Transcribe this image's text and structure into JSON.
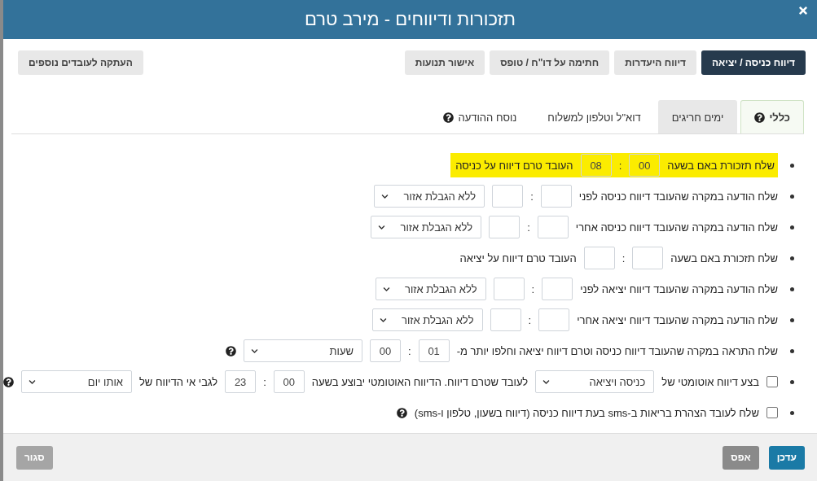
{
  "window": {
    "title": "תזכורות ודיווחים - מירב טרם"
  },
  "top_buttons": [
    {
      "label": "דיווח כניסה / יציאה",
      "selected": true
    },
    {
      "label": "דיווח היעדרות",
      "selected": false
    },
    {
      "label": "חתימה על דו\"ח / טופס",
      "selected": false
    },
    {
      "label": "אישור תנועות",
      "selected": false
    }
  ],
  "copy_button": {
    "label": "העתקה לעובדים נוספים"
  },
  "tabs": [
    {
      "label": "כללי",
      "selected": true,
      "help": true
    },
    {
      "label": "ימים חריגים",
      "selected": false,
      "help": false
    },
    {
      "label": "דוא\"ל וטלפון למשלוח",
      "selected": false,
      "help": false
    },
    {
      "label": "נוסח ההודעה",
      "selected": false,
      "help": true
    }
  ],
  "rows": [
    {
      "highlighted": true,
      "parts": [
        {
          "kind": "text",
          "text": "שלח תזכורת באם בשעה"
        },
        {
          "kind": "input",
          "value": "00"
        },
        {
          "kind": "text",
          "text": ":"
        },
        {
          "kind": "input",
          "value": "08"
        },
        {
          "kind": "text",
          "text": "העובד טרם דיווח על כניסה"
        }
      ]
    },
    {
      "highlighted": false,
      "parts": [
        {
          "kind": "text",
          "text": "שלח הודעה במקרה שהעובד דיווח כניסה לפני"
        },
        {
          "kind": "input"
        },
        {
          "kind": "text",
          "text": ":"
        },
        {
          "kind": "input"
        },
        {
          "kind": "select",
          "value": "ללא הגבלת אזור"
        }
      ]
    },
    {
      "highlighted": false,
      "parts": [
        {
          "kind": "text",
          "text": "שלח הודעה במקרה שהעובד דיווח כניסה אחרי"
        },
        {
          "kind": "input"
        },
        {
          "kind": "text",
          "text": ":"
        },
        {
          "kind": "input"
        },
        {
          "kind": "select",
          "value": "ללא הגבלת אזור"
        }
      ]
    },
    {
      "highlighted": false,
      "parts": [
        {
          "kind": "text",
          "text": "שלח תזכורת באם בשעה"
        },
        {
          "kind": "input"
        },
        {
          "kind": "text",
          "text": ":"
        },
        {
          "kind": "input"
        },
        {
          "kind": "text",
          "text": "העובד טרם דיווח על יציאה"
        }
      ]
    },
    {
      "highlighted": false,
      "parts": [
        {
          "kind": "text",
          "text": "שלח הודעה במקרה שהעובד דיווח יציאה לפני"
        },
        {
          "kind": "input"
        },
        {
          "kind": "text",
          "text": ":"
        },
        {
          "kind": "input"
        },
        {
          "kind": "select",
          "value": "ללא הגבלת אזור"
        }
      ]
    },
    {
      "highlighted": false,
      "parts": [
        {
          "kind": "text",
          "text": "שלח הודעה במקרה שהעובד דיווח יציאה אחרי"
        },
        {
          "kind": "input"
        },
        {
          "kind": "text",
          "text": ":"
        },
        {
          "kind": "input"
        },
        {
          "kind": "select",
          "value": "ללא הגבלת אזור"
        }
      ]
    },
    {
      "highlighted": false,
      "parts": [
        {
          "kind": "text",
          "text": "שלח התראה במקרה שהעובד דיווח כניסה וטרם דיווח יציאה וחלפו יותר מ-"
        },
        {
          "kind": "input",
          "value": "01"
        },
        {
          "kind": "text",
          "text": ":"
        },
        {
          "kind": "input",
          "value": "00"
        },
        {
          "kind": "select",
          "value": "שעות",
          "wide": true
        },
        {
          "kind": "help"
        }
      ]
    },
    {
      "highlighted": false,
      "parts": [
        {
          "kind": "checkbox",
          "checked": false
        },
        {
          "kind": "text",
          "text": "בצע דיווח אוטומטי של"
        },
        {
          "kind": "select",
          "value": "כניסה ויציאה",
          "wide": true
        },
        {
          "kind": "text",
          "text": "לעובד שטרם דיווח. הדיווח האוטומטי יבוצע בשעה"
        },
        {
          "kind": "input",
          "value": "00"
        },
        {
          "kind": "text",
          "text": ":"
        },
        {
          "kind": "input",
          "value": "23"
        },
        {
          "kind": "text",
          "text": "לגבי אי הדיווח של"
        },
        {
          "kind": "select",
          "value": "אותו יום"
        },
        {
          "kind": "help"
        }
      ]
    },
    {
      "highlighted": false,
      "parts": [
        {
          "kind": "checkbox",
          "checked": false
        },
        {
          "kind": "text",
          "text": "שלח לעובד הצהרת בריאות ב-sms בעת דיווח כניסה (דיווח בשעון, טלפון ו-sms)"
        },
        {
          "kind": "help"
        }
      ]
    }
  ],
  "footer": {
    "buttons": [
      {
        "label": "עדכן",
        "kind": "primary"
      },
      {
        "label": "אפס",
        "kind": "reset"
      }
    ],
    "close": {
      "label": "סגור"
    }
  }
}
